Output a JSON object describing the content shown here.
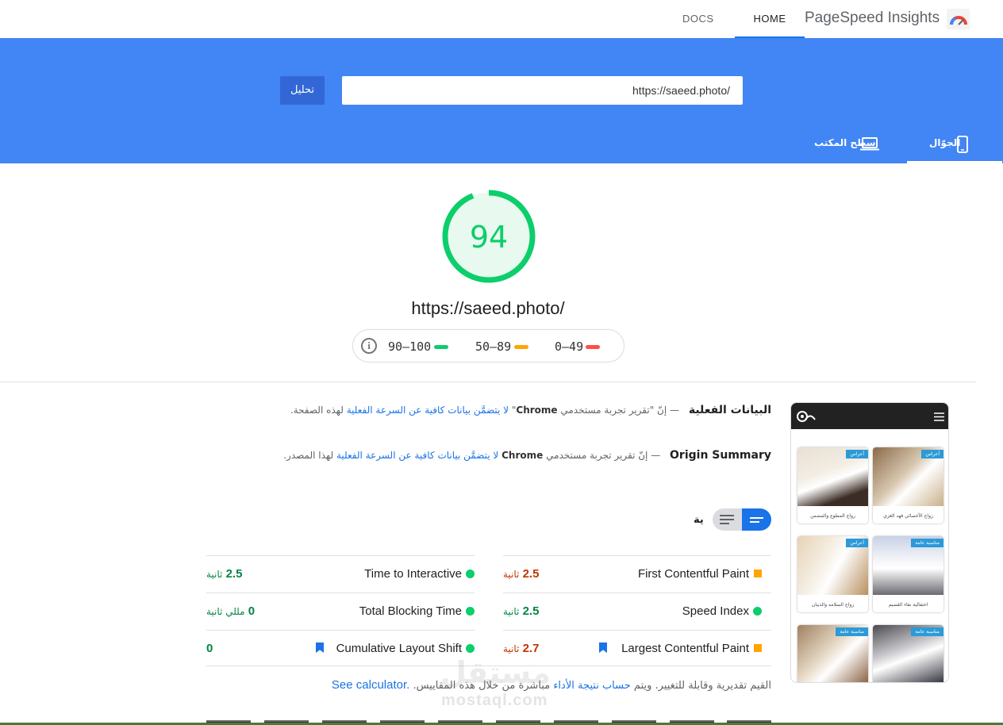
{
  "header": {
    "brand": "PageSpeed Insights",
    "nav": {
      "docs": "DOCS",
      "home": "HOME"
    }
  },
  "search": {
    "url_value": "https://saeed.photo/",
    "analyze_label": "تحليل"
  },
  "device_tabs": {
    "mobile": "الجوّال",
    "desktop": "سطح المكتب"
  },
  "result": {
    "score": "94",
    "url": "https://saeed.photo/",
    "legend": {
      "good": "90–100",
      "average": "50–89",
      "poor": "0–49"
    }
  },
  "field_data": {
    "title": "البيانات الفعلية",
    "dash": "—",
    "text_prefix": "إنّ \"تقرير تجربة مستخدمي",
    "chrome": "Chrome",
    "text_mid": "\"",
    "link": "لا يتضمَّن بيانات كافية عن السرعة الفعلية",
    "text_suffix": "لهذه الصفحة."
  },
  "origin_summary": {
    "title": "Origin Summary",
    "dash": "—",
    "text_prefix": "إنّ تقرير تجربة مستخدمي",
    "chrome": "Chrome",
    "link": "لا يتضمَّن بيانات كافية عن السرعة الفعلية",
    "text_suffix": "لهذا المصدر."
  },
  "lab": {
    "label": "ية"
  },
  "metrics": [
    {
      "name": "First Contentful Paint",
      "value": "2.5",
      "unit": "ثانية",
      "status": "average"
    },
    {
      "name": "Time to Interactive",
      "value": "2.5",
      "unit": "ثانية",
      "status": "good"
    },
    {
      "name": "Speed Index",
      "value": "2.5",
      "unit": "ثانية",
      "status": "good"
    },
    {
      "name": "Total Blocking Time",
      "value": "0",
      "unit": "مللي ثانية",
      "status": "good"
    },
    {
      "name": "Largest Contentful Paint",
      "value": "2.7",
      "unit": "ثانية",
      "status": "average"
    },
    {
      "name": "Cumulative Layout Shift",
      "value": "0",
      "unit": "",
      "status": "good"
    }
  ],
  "calc_note": {
    "prefix": "القيم تقديرية وقابلة للتغيير. ويتم",
    "link": "حساب نتيجة الأداء",
    "suffix": "مباشرة من خلال هذه المقاييس.",
    "calc_link": "See calculator."
  },
  "preview_cards": [
    {
      "tag": "أعراس",
      "caption": "زواج الأخصائي فهد الغزي"
    },
    {
      "tag": "أعراس",
      "caption": "زواج المطوع والمضمن"
    },
    {
      "tag": "مناسبة عامة",
      "caption": "احتفالية نقاء القصيم"
    },
    {
      "tag": "أعراس",
      "caption": "زواج السلامه والذيبان"
    },
    {
      "tag": "مناسبة عامة",
      "caption": ""
    },
    {
      "tag": "مناسبة عامة",
      "caption": ""
    }
  ],
  "watermark": {
    "ar": "مستقل",
    "en": "mostaql.com"
  },
  "colors": {
    "good": "#0cce6b",
    "average": "#ffa400",
    "poor": "#ff4e42",
    "hero": "#4285f4",
    "link": "#1a73e8"
  }
}
